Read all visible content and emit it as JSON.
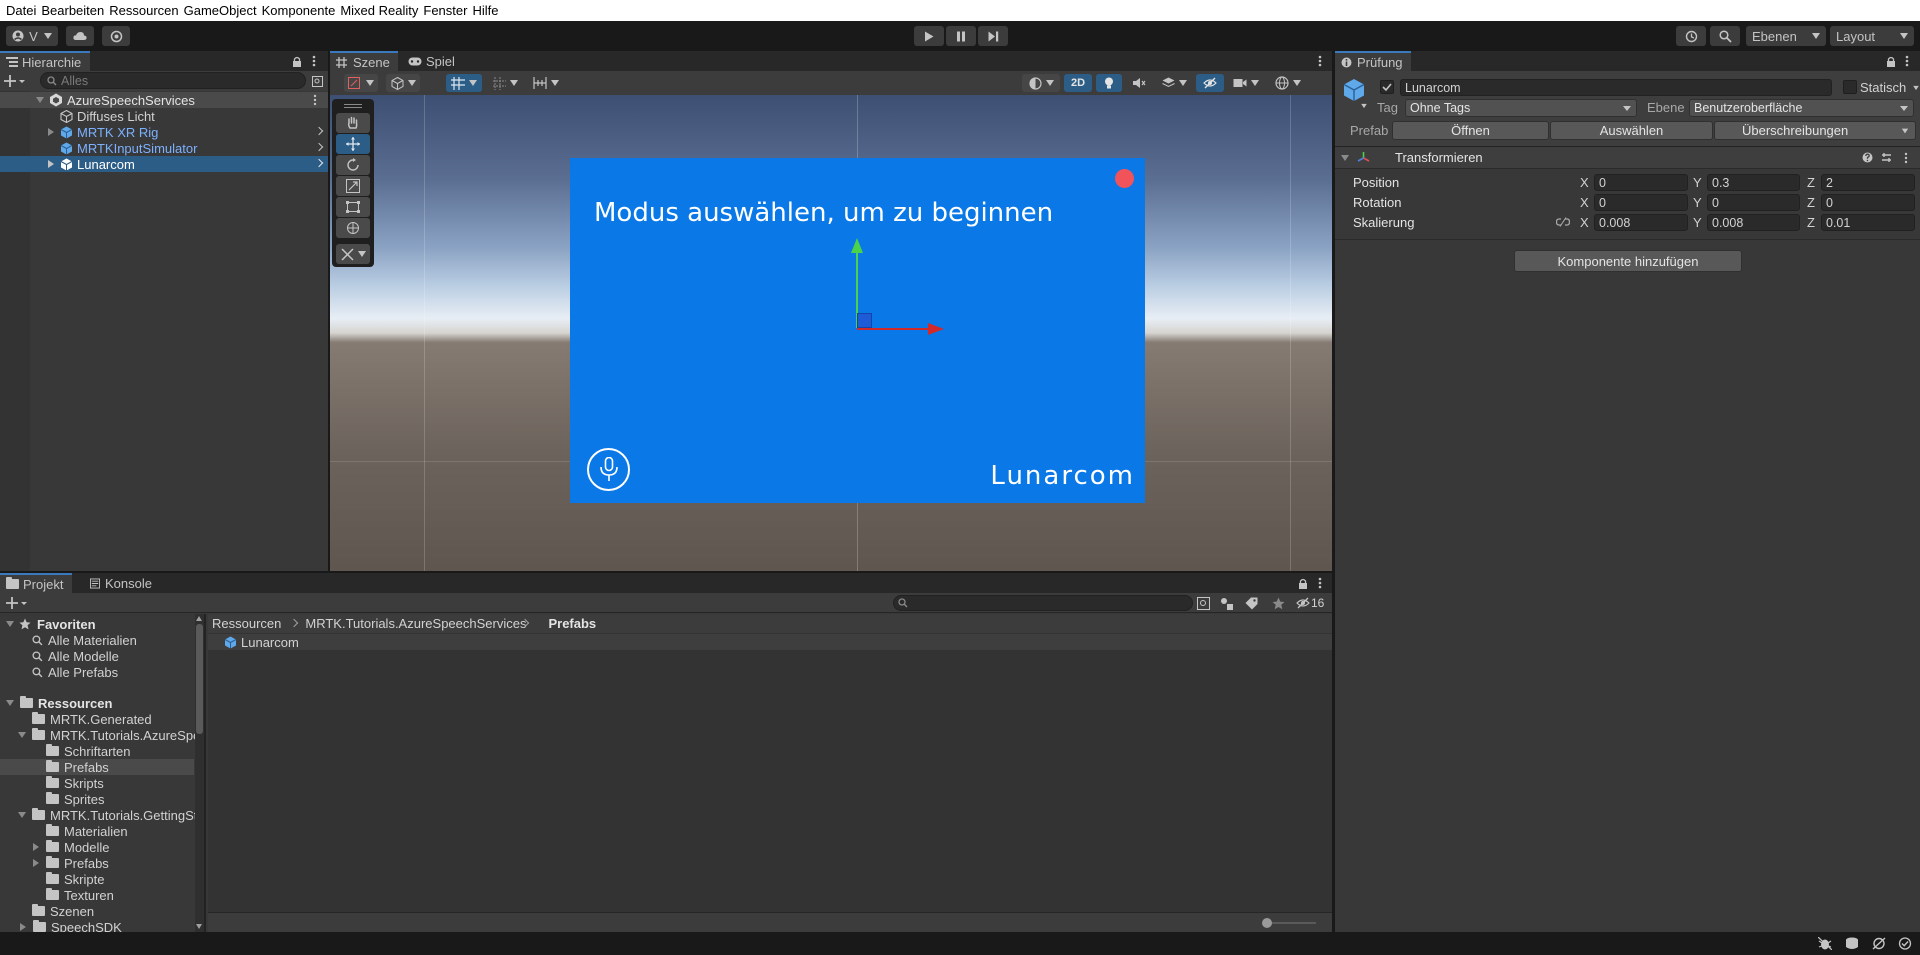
{
  "menu": [
    "Datei",
    "Bearbeiten",
    "Ressourcen",
    "GameObject",
    "Komponente",
    "Mixed Reality",
    "Fenster",
    "Hilfe"
  ],
  "toolbar": {
    "account_label": "V",
    "layers_label": "Ebenen",
    "layout_label": "Layout"
  },
  "hierarchy": {
    "tab_label": "Hierarchie",
    "search_placeholder": "Alles",
    "scene_name": "AzureSpeechServices",
    "items": [
      {
        "label": "Diffuses Licht"
      },
      {
        "label": "MRTK XR Rig"
      },
      {
        "label": "MRTKInputSimulator"
      },
      {
        "label": "Lunarcom"
      }
    ]
  },
  "scene": {
    "tab_scene": "Szene",
    "tab_game": "Spiel",
    "btn_2d": "2D",
    "canvas_text": "Modus auswählen, um zu beginnen",
    "canvas_brand": "Lunarcom"
  },
  "inspector": {
    "tab_label": "Prüfung",
    "object_name": "Lunarcom",
    "static_label": "Statisch",
    "tag_label": "Tag",
    "tag_value": "Ohne Tags",
    "layer_label": "Ebene",
    "layer_value": "Benutzeroberfläche",
    "prefab_label": "Prefab",
    "open_label": "Öffnen",
    "select_label": "Auswählen",
    "overrides_label": "Überschreibungen",
    "transform_label": "Transformieren",
    "position_label": "Position",
    "rotation_label": "Rotation",
    "scale_label": "Skalierung",
    "position": {
      "x": "0",
      "y": "0.3",
      "z": "2"
    },
    "rotation": {
      "x": "0",
      "y": "0",
      "z": "0"
    },
    "scale": {
      "x": "0.008",
      "y": "0.008",
      "z": "0.01"
    },
    "axis_x": "X",
    "axis_y": "Y",
    "axis_z": "Z",
    "add_component_label": "Komponente hinzufügen"
  },
  "project": {
    "tab_project": "Projekt",
    "tab_console": "Konsole",
    "hidden_count": "16",
    "favorites_label": "Favoriten",
    "favorites": [
      "Alle Materialien",
      "Alle Modelle",
      "Alle Prefabs"
    ],
    "resources_label": "Ressourcen",
    "tree": [
      {
        "label": "MRTK.Generated"
      },
      {
        "label": "MRTK.Tutorials.AzureSpee"
      },
      {
        "label": "Schriftarten"
      },
      {
        "label": "Prefabs"
      },
      {
        "label": "Skripts"
      },
      {
        "label": "Sprites"
      },
      {
        "label": "MRTK.Tutorials.GettingSta"
      },
      {
        "label": "Materialien"
      },
      {
        "label": "Modelle"
      },
      {
        "label": "Prefabs"
      },
      {
        "label": "Skripte"
      },
      {
        "label": "Texturen"
      },
      {
        "label": "Szenen"
      },
      {
        "label": "SpeechSDK"
      }
    ],
    "breadcrumb": [
      "Ressourcen",
      "MRTK.Tutorials.AzureSpeechServices",
      "Prefabs"
    ],
    "asset": "Lunarcom"
  },
  "colors": {
    "accent": "#3a79bb",
    "canvas_blue": "#0a78e6",
    "selection": "#2c5d87",
    "record_red": "#f0535a"
  }
}
